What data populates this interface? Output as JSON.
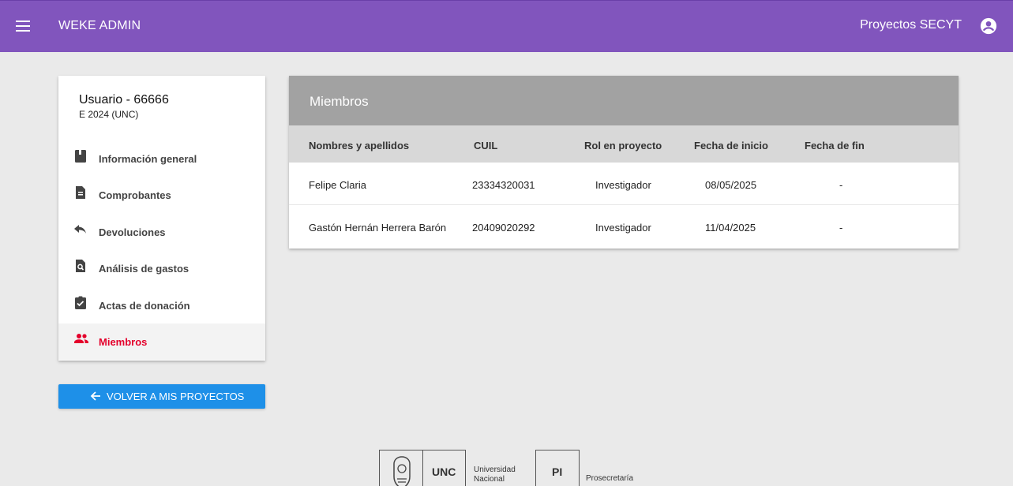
{
  "topbar": {
    "app_title": "WEKE ADMIN",
    "project_title": "Proyectos SECYT",
    "icons": {
      "menu": "menu-icon",
      "account": "account-circle-icon"
    },
    "color": "#8155bd"
  },
  "sidebar": {
    "user_name": "Usuario - 66666",
    "user_sub": "E 2024 (UNC)",
    "items": [
      {
        "label": "Información general",
        "icon": "book-icon"
      },
      {
        "label": "Comprobantes",
        "icon": "document-icon"
      },
      {
        "label": "Devoluciones",
        "icon": "reply-icon"
      },
      {
        "label": "Análisis de gastos",
        "icon": "search-document-icon"
      },
      {
        "label": "Actas de donación",
        "icon": "clipboard-check-icon"
      },
      {
        "label": "Miembros",
        "icon": "people-icon",
        "active": true
      }
    ],
    "active_color": "#e4002b"
  },
  "back_button": {
    "label": "VOLVER A MIS PROYECTOS",
    "icon": "arrow-left-icon",
    "color": "#1e90e8"
  },
  "members": {
    "title": "Miembros",
    "columns": [
      "Nombres y apellidos",
      "CUIL",
      "Rol en proyecto",
      "Fecha de inicio",
      "Fecha de fin"
    ],
    "rows": [
      [
        "Felipe Claria",
        "23334320031",
        "Investigador",
        "08/05/2025",
        "-"
      ],
      [
        "Gastón Hernán Herrera Barón",
        "20409020292",
        "Investigador",
        "11/04/2025",
        "-"
      ]
    ]
  },
  "footer": {
    "unc_label": "UNC",
    "unc_sub_1": "Universidad",
    "unc_sub_2": "Nacional",
    "pi_label": "PI",
    "pi_sub": "Prosecretaría"
  }
}
